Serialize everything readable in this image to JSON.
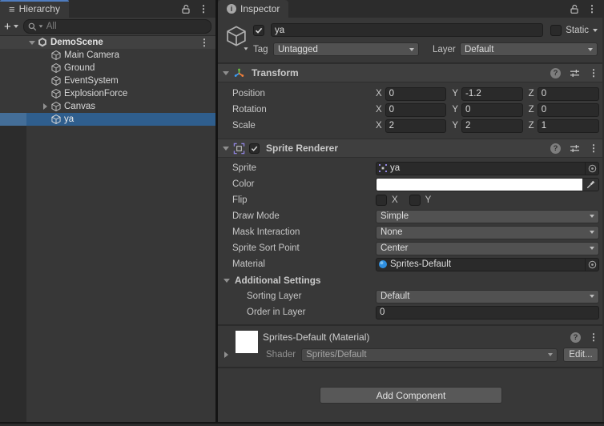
{
  "icons": {
    "hierarchy_list": "≡",
    "kebab": "⋮",
    "plus": "+",
    "info": "i",
    "help": "?"
  },
  "colors": {
    "selection_blue": "#2F5E8D",
    "tab_accent_blue": "#4F7CBF",
    "color_swatch": "#FFFFFF"
  },
  "hierarchy": {
    "tab_label": "Hierarchy",
    "search_placeholder": "All",
    "scene": {
      "label": "DemoScene"
    },
    "items": [
      {
        "label": "Main Camera"
      },
      {
        "label": "Ground"
      },
      {
        "label": "EventSystem"
      },
      {
        "label": "ExplosionForce"
      },
      {
        "label": "Canvas"
      },
      {
        "label": "ya"
      }
    ]
  },
  "inspector": {
    "tab_label": "Inspector",
    "header": {
      "name_value": "ya",
      "static_label": "Static",
      "tag_label": "Tag",
      "tag_value": "Untagged",
      "layer_label": "Layer",
      "layer_value": "Default"
    },
    "transform": {
      "title": "Transform",
      "axis": {
        "x": "X",
        "y": "Y",
        "z": "Z"
      },
      "rows": [
        {
          "label": "Position",
          "x": "0",
          "y": "-1.2",
          "z": "0"
        },
        {
          "label": "Rotation",
          "x": "0",
          "y": "0",
          "z": "0"
        },
        {
          "label": "Scale",
          "x": "2",
          "y": "2",
          "z": "1"
        }
      ]
    },
    "sprite_renderer": {
      "title": "Sprite Renderer",
      "sprite": {
        "label": "Sprite",
        "value": "ya"
      },
      "color": {
        "label": "Color"
      },
      "flip": {
        "label": "Flip",
        "x": "X",
        "y": "Y"
      },
      "draw_mode": {
        "label": "Draw Mode",
        "value": "Simple"
      },
      "mask_interaction": {
        "label": "Mask Interaction",
        "value": "None"
      },
      "sprite_sort_point": {
        "label": "Sprite Sort Point",
        "value": "Center"
      },
      "material": {
        "label": "Material",
        "value": "Sprites-Default"
      },
      "additional_settings": {
        "label": "Additional Settings"
      },
      "sorting_layer": {
        "label": "Sorting Layer",
        "value": "Default"
      },
      "order_in_layer": {
        "label": "Order in Layer",
        "value": "0"
      }
    },
    "material_preview": {
      "title": "Sprites-Default (Material)",
      "shader_label": "Shader",
      "shader_value": "Sprites/Default",
      "edit_button": "Edit..."
    },
    "add_component_button": "Add Component"
  }
}
